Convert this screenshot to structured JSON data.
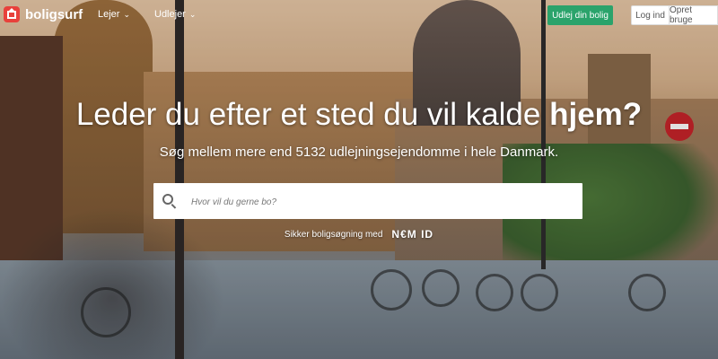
{
  "brand": {
    "name": "boligsurf",
    "logo_color": "#e8413b"
  },
  "nav": [
    {
      "label": "Lejer",
      "icon": "chevron-down-icon"
    },
    {
      "label": "Udlejer",
      "icon": "chevron-down-icon"
    }
  ],
  "header_actions": {
    "rent_out": "Udlej din bolig",
    "login": "Log ind",
    "signup": "Opret bruge"
  },
  "hero": {
    "headline_main": "Leder du efter et sted du vil kalde ",
    "headline_bold": "hjem?",
    "subline": "Søg mellem mere end 5132 udlejningsejendomme i hele Danmark."
  },
  "search": {
    "placeholder": "Hvor vil du gerne bo?",
    "icon": "search-icon"
  },
  "trust": {
    "text": "Sikker boligsøgning med",
    "logo_text": "N€M ID"
  },
  "colors": {
    "accent_green": "#2aa36b",
    "brand_red": "#e8413b"
  }
}
